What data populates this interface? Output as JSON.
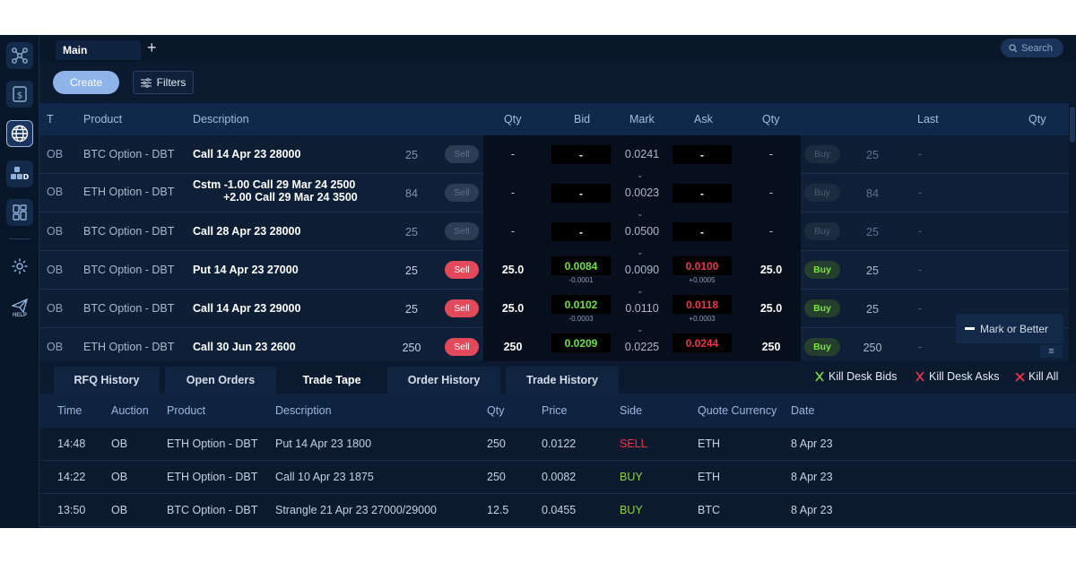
{
  "top_bar": {
    "tab_main": "Main",
    "add_tab": "+",
    "search_placeholder": "Search"
  },
  "toolbar": {
    "create_label": "Create",
    "filters_label": "Filters"
  },
  "sidebar": {
    "help_label": "HELP"
  },
  "quotes": {
    "columns": {
      "t": "T",
      "product": "Product",
      "description": "Description",
      "qty_bid": "Qty",
      "bid": "Bid",
      "mark": "Mark",
      "ask": "Ask",
      "qty_ask": "Qty",
      "last": "Last",
      "qty_last": "Qty"
    },
    "rows": [
      {
        "type": "OB",
        "product": "BTC Option - DBT",
        "desc1": "Call 14 Apr 23 28000",
        "desc2": "",
        "bid_qty": "25",
        "sell": "Sell",
        "qty1": "-",
        "bid": "-",
        "bid_sub": "",
        "mark": "0.0241",
        "ask": "-",
        "ask_sub": "",
        "qty2": "-",
        "buy": "Buy",
        "last_qty": "25",
        "last": "-"
      },
      {
        "type": "OB",
        "product": "ETH Option - DBT",
        "desc1": "Cstm -1.00 Call 29 Mar 24 2500",
        "desc2": "+2.00 Call 29 Mar 24 3500",
        "bid_qty": "84",
        "sell": "Sell",
        "qty1": "-",
        "bid": "-",
        "bid_sub": "",
        "mark": "0.0023",
        "ask": "-",
        "ask_sub": "",
        "qty2": "-",
        "buy": "Buy",
        "last_qty": "84",
        "last": "-"
      },
      {
        "type": "OB",
        "product": "BTC Option - DBT",
        "desc1": "Call 28 Apr 23 28000",
        "desc2": "",
        "bid_qty": "25",
        "sell": "Sell",
        "qty1": "-",
        "bid": "-",
        "bid_sub": "",
        "mark": "0.0500",
        "ask": "-",
        "ask_sub": "",
        "qty2": "-",
        "buy": "Buy",
        "last_qty": "25",
        "last": "-"
      },
      {
        "type": "OB",
        "product": "BTC Option - DBT",
        "desc1": "Put 14 Apr 23 27000",
        "desc2": "",
        "bid_qty": "25",
        "sell": "Sell",
        "qty1": "25.0",
        "bid": "0.0084",
        "bid_sub": "-0.0001",
        "mark": "0.0090",
        "ask": "0.0100",
        "ask_sub": "+0.0005",
        "qty2": "25.0",
        "buy": "Buy",
        "last_qty": "25",
        "last": "-"
      },
      {
        "type": "OB",
        "product": "BTC Option - DBT",
        "desc1": "Call 14 Apr 23 29000",
        "desc2": "",
        "bid_qty": "25",
        "sell": "Sell",
        "qty1": "25.0",
        "bid": "0.0102",
        "bid_sub": "-0.0003",
        "mark": "0.0110",
        "ask": "0.0118",
        "ask_sub": "+0.0003",
        "qty2": "25.0",
        "buy": "Buy",
        "last_qty": "25",
        "last": "-"
      },
      {
        "type": "OB",
        "product": "ETH Option - DBT",
        "desc1": "Call 30 Jun 23 2600",
        "desc2": "",
        "bid_qty": "250",
        "sell": "Sell",
        "qty1": "250",
        "bid": "0.0209",
        "bid_sub": "",
        "mark": "0.0225",
        "ask": "0.0244",
        "ask_sub": "",
        "qty2": "250",
        "buy": "Buy",
        "last_qty": "250",
        "last": "-"
      }
    ],
    "mark_or_better": "Mark or Better"
  },
  "bottom_tabs": [
    "RFQ History",
    "Open Orders",
    "Trade Tape",
    "Order History",
    "Trade History"
  ],
  "active_tab": "Trade Tape",
  "kill_actions": {
    "kill_bids": "Kill Desk Bids",
    "kill_asks": "Kill Desk Asks",
    "kill_all": "Kill All"
  },
  "trades": {
    "columns": {
      "time": "Time",
      "auction": "Auction",
      "product": "Product",
      "description": "Description",
      "qty": "Qty",
      "price": "Price",
      "side": "Side",
      "quote_currency": "Quote Currency",
      "date": "Date"
    },
    "rows": [
      {
        "time": "14:48",
        "auction": "OB",
        "product": "ETH Option - DBT",
        "description": "Put 14 Apr 23 1800",
        "qty": "250",
        "price": "0.0122",
        "side": "SELL",
        "quote_currency": "ETH",
        "date": "8 Apr 23"
      },
      {
        "time": "14:22",
        "auction": "OB",
        "product": "ETH Option - DBT",
        "description": "Call 10 Apr 23 1875",
        "qty": "250",
        "price": "0.0082",
        "side": "BUY",
        "quote_currency": "ETH",
        "date": "8 Apr 23"
      },
      {
        "time": "13:50",
        "auction": "OB",
        "product": "BTC Option - DBT",
        "description": "Strangle 21 Apr 23 27000/29000",
        "qty": "12.5",
        "price": "0.0455",
        "side": "BUY",
        "quote_currency": "BTC",
        "date": "8 Apr 23"
      }
    ]
  },
  "colors": {
    "background": "#0b1a2e",
    "accent": "#8fb4ea",
    "sell": "#e24a5c",
    "buy": "#7ee040",
    "bid_green": "#6de044",
    "ask_red": "#f0334b"
  }
}
